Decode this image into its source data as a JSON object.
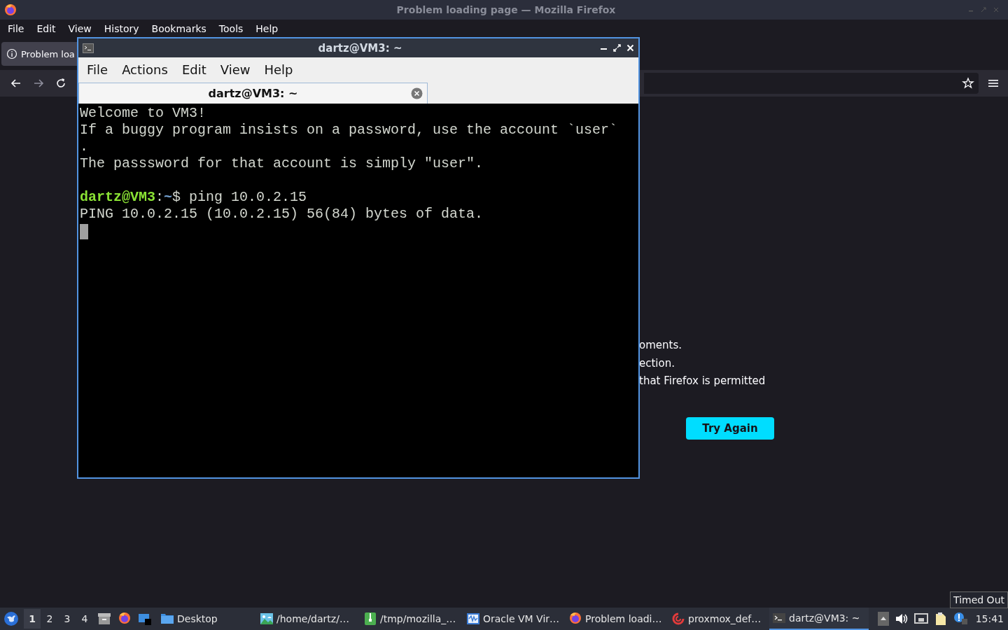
{
  "firefox": {
    "title": "Problem loading page — Mozilla Firefox",
    "menu": [
      "File",
      "Edit",
      "View",
      "History",
      "Bookmarks",
      "Tools",
      "Help"
    ],
    "tabs": [
      {
        "label": "Problem loa",
        "selected": true
      }
    ],
    "error_lines": [
      "oments.",
      "ection.",
      "that Firefox is permitted"
    ],
    "try_again": "Try Again"
  },
  "terminal": {
    "title": "dartz@VM3: ~",
    "menu": [
      "File",
      "Actions",
      "Edit",
      "View",
      "Help"
    ],
    "tabs": [
      {
        "label": "dartz@VM3: ~",
        "selected": true
      }
    ],
    "lines": [
      {
        "kind": "text",
        "text": "Welcome to VM3!"
      },
      {
        "kind": "text",
        "text": "If a buggy program insists on a password, use the account `user`"
      },
      {
        "kind": "text",
        "text": "."
      },
      {
        "kind": "text",
        "text": "The passsword for that account is simply \"user\"."
      },
      {
        "kind": "blank"
      },
      {
        "kind": "prompt",
        "user": "dartz@VM3",
        "sep": ":",
        "path": "~",
        "command": "$ ping 10.0.2.15"
      },
      {
        "kind": "text",
        "text": "PING 10.0.2.15 (10.0.2.15) 56(84) bytes of data."
      },
      {
        "kind": "cursor"
      }
    ]
  },
  "taskbar": {
    "workspaces": [
      {
        "label": "1",
        "selected": true
      },
      {
        "label": "2",
        "selected": false
      },
      {
        "label": "3",
        "selected": false
      },
      {
        "label": "4",
        "selected": false
      }
    ],
    "tasks": [
      {
        "kind": "folder",
        "label": "Desktop",
        "active": false
      },
      {
        "kind": "image",
        "label": "/home/dartz/…",
        "active": false
      },
      {
        "kind": "archive",
        "label": "/tmp/mozilla_…",
        "active": false
      },
      {
        "kind": "vm",
        "label": "Oracle VM Vir…",
        "active": false
      },
      {
        "kind": "firefox",
        "label": "Problem loadi…",
        "active": false
      },
      {
        "kind": "swirl",
        "label": "proxmox_def…",
        "active": false
      },
      {
        "kind": "terminal",
        "label": "dartz@VM3: ~",
        "active": true
      }
    ],
    "clock": "15:41",
    "tooltip": "Timed Out"
  }
}
